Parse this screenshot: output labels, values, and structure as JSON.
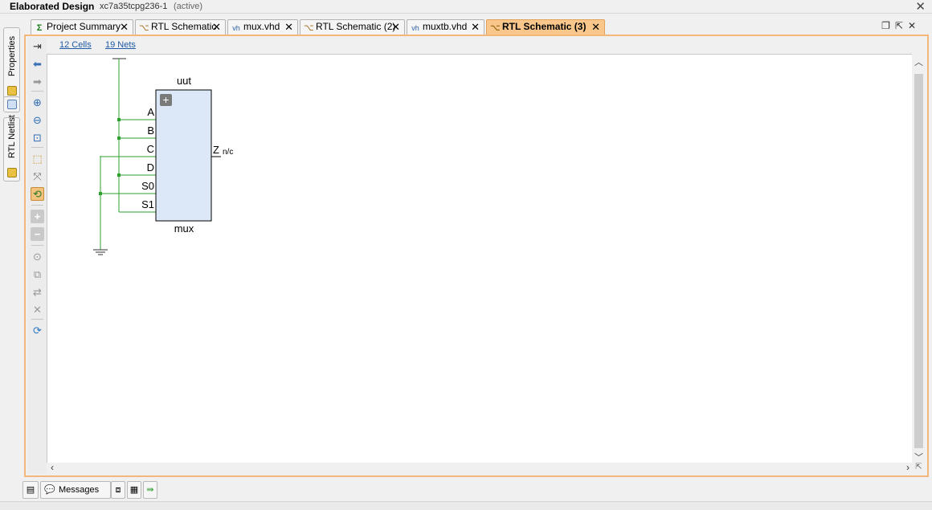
{
  "title_bar": {
    "design": "Elaborated Design",
    "part": "xc7a35tcpg236-1",
    "state": "(active)"
  },
  "side_tabs": [
    {
      "label": "Properties",
      "icon": "properties-icon"
    },
    {
      "label": "RTL Netlist",
      "icon": "netlist-icon"
    }
  ],
  "tabs": [
    {
      "label": "Project Summary",
      "icon": "sigma-icon",
      "active": false
    },
    {
      "label": "RTL Schematic",
      "icon": "schematic-icon",
      "active": false
    },
    {
      "label": "mux.vhd",
      "icon": "vhdl-icon",
      "active": false
    },
    {
      "label": "RTL Schematic (2)",
      "icon": "schematic-icon",
      "active": false
    },
    {
      "label": "muxtb.vhd",
      "icon": "vhdl-icon",
      "active": false
    },
    {
      "label": "RTL Schematic (3)",
      "icon": "schematic-icon",
      "active": true
    }
  ],
  "info": {
    "cells": "12 Cells",
    "nets": "19 Nets"
  },
  "schematic": {
    "instance_name": "uut",
    "cell_type": "mux",
    "expand_symbol": "+",
    "inputs": [
      "A",
      "B",
      "C",
      "D",
      "S0",
      "S1"
    ],
    "output": "Z",
    "output_net": "n/c",
    "colors": {
      "wire": "#2ea02e",
      "block_fill": "#dce8f7",
      "block_border": "#000000"
    }
  },
  "bottom_tabs": [
    {
      "label": "Messages",
      "icon": "messages-icon"
    }
  ]
}
